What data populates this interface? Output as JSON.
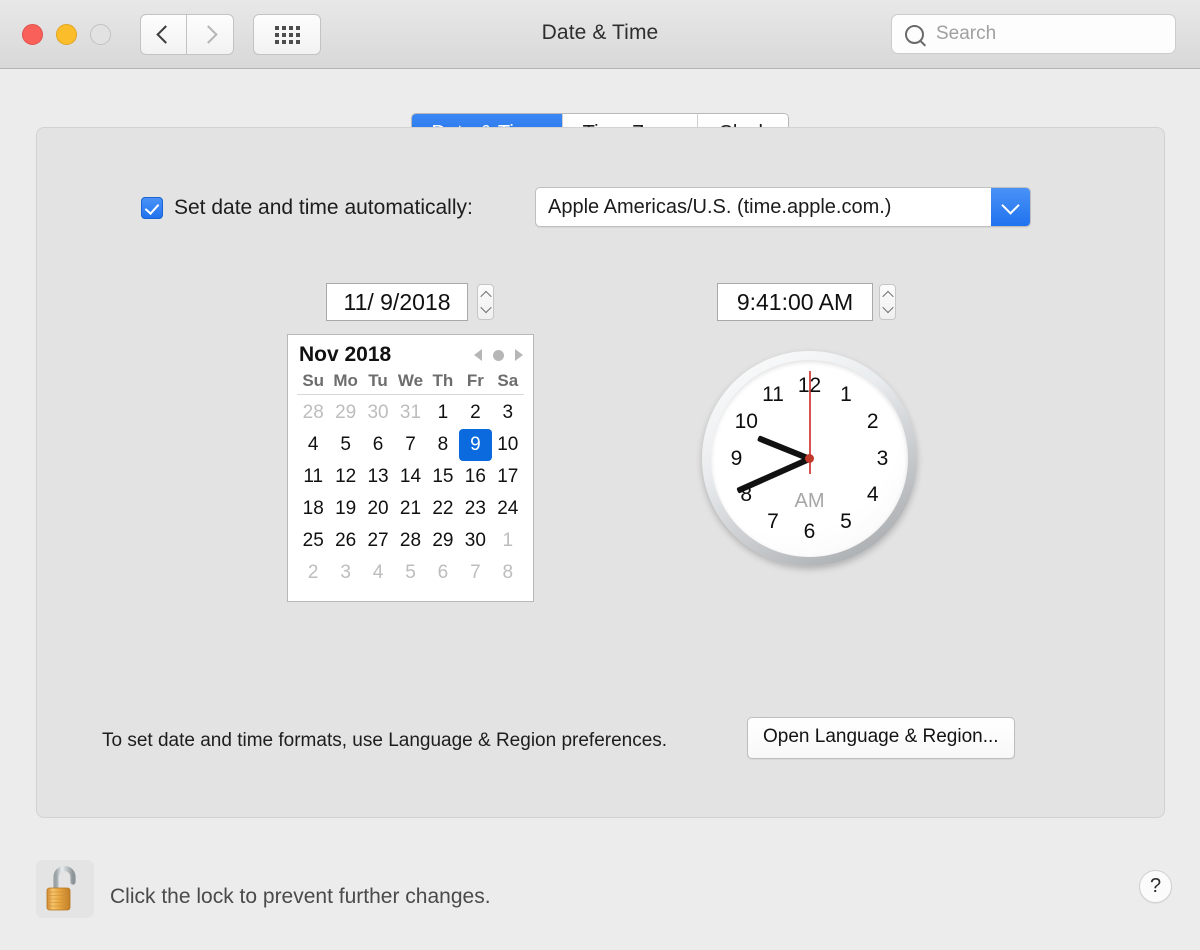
{
  "window": {
    "title": "Date & Time",
    "traffic_lights": [
      "close",
      "minimize",
      "zoom"
    ],
    "nav": {
      "back": "back-arrow",
      "forward": "forward-arrow",
      "show_all": "grid-icon"
    },
    "search": {
      "placeholder": "Search",
      "value": "",
      "icon": "search-icon"
    }
  },
  "tabs": [
    {
      "label": "Date & Time",
      "active": true
    },
    {
      "label": "Time Zone",
      "active": false
    },
    {
      "label": "Clock",
      "active": false
    }
  ],
  "main": {
    "auto_set": {
      "checked": true,
      "label": "Set date and time automatically:",
      "server_value": "Apple Americas/U.S. (time.apple.com.)"
    },
    "date_field": {
      "value": "11/  9/2018",
      "stepper": "stepper-icon"
    },
    "time_field": {
      "value": "9:41:00 AM",
      "stepper": "stepper-icon"
    },
    "calendar": {
      "month_label": "Nov 2018",
      "nav": {
        "prev": "prev-arrow-icon",
        "today": "today-dot-icon",
        "next": "next-arrow-icon"
      },
      "weekdays": [
        "Su",
        "Mo",
        "Tu",
        "We",
        "Th",
        "Fr",
        "Sa"
      ],
      "weeks": [
        [
          {
            "d": "28",
            "muted": true
          },
          {
            "d": "29",
            "muted": true
          },
          {
            "d": "30",
            "muted": true
          },
          {
            "d": "31",
            "muted": true
          },
          {
            "d": "1"
          },
          {
            "d": "2"
          },
          {
            "d": "3"
          }
        ],
        [
          {
            "d": "4"
          },
          {
            "d": "5"
          },
          {
            "d": "6"
          },
          {
            "d": "7"
          },
          {
            "d": "8"
          },
          {
            "d": "9",
            "selected": true
          },
          {
            "d": "10"
          }
        ],
        [
          {
            "d": "11"
          },
          {
            "d": "12"
          },
          {
            "d": "13"
          },
          {
            "d": "14"
          },
          {
            "d": "15"
          },
          {
            "d": "16"
          },
          {
            "d": "17"
          }
        ],
        [
          {
            "d": "18"
          },
          {
            "d": "19"
          },
          {
            "d": "20"
          },
          {
            "d": "21"
          },
          {
            "d": "22"
          },
          {
            "d": "23"
          },
          {
            "d": "24"
          }
        ],
        [
          {
            "d": "25"
          },
          {
            "d": "26"
          },
          {
            "d": "27"
          },
          {
            "d": "28"
          },
          {
            "d": "29"
          },
          {
            "d": "30"
          },
          {
            "d": "1",
            "muted": true
          }
        ],
        [
          {
            "d": "2",
            "muted": true
          },
          {
            "d": "3",
            "muted": true
          },
          {
            "d": "4",
            "muted": true
          },
          {
            "d": "5",
            "muted": true
          },
          {
            "d": "6",
            "muted": true
          },
          {
            "d": "7",
            "muted": true
          },
          {
            "d": "8",
            "muted": true
          }
        ]
      ]
    },
    "clock": {
      "numerals": [
        "12",
        "1",
        "2",
        "3",
        "4",
        "5",
        "6",
        "7",
        "8",
        "9",
        "10",
        "11"
      ],
      "period_label": "AM",
      "hour": 9,
      "minute": 41,
      "second": 0,
      "hour_angle": 292,
      "minute_angle": 246,
      "second_angle": 0,
      "second_hand_color": "#d9534f"
    },
    "note_text": "To set date and time formats, use Language & Region preferences.",
    "note_button": "Open Language & Region..."
  },
  "lockbar": {
    "lock_icon": "unlocked-padlock-icon",
    "text": "Click the lock to prevent further changes.",
    "help_label": "?"
  },
  "colors": {
    "accent_blue": "#1f72ef",
    "selected_day_blue": "#0b6ade",
    "window_bg": "#ececec",
    "panel_bg": "#e3e3e3"
  }
}
